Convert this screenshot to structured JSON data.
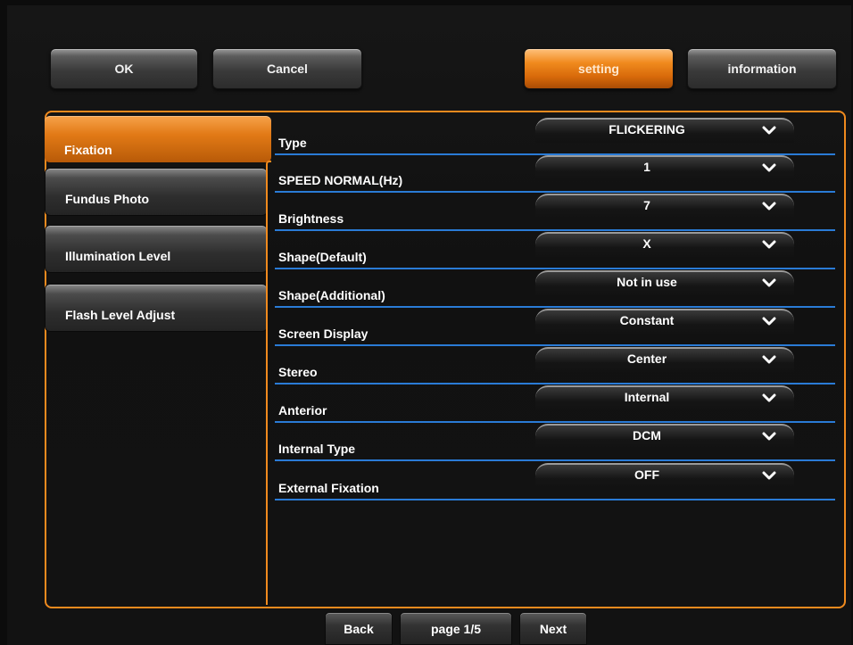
{
  "toolbar": {
    "ok": "OK",
    "cancel": "Cancel",
    "setting": "setting",
    "information": "information"
  },
  "sidebar": {
    "items": [
      {
        "label": "Fixation",
        "active": true
      },
      {
        "label": "Fundus Photo",
        "active": false
      },
      {
        "label": "Illumination Level",
        "active": false
      },
      {
        "label": "Flash Level Adjust",
        "active": false
      }
    ]
  },
  "settings": {
    "rows": [
      {
        "label": "Type",
        "value": "FLICKERING"
      },
      {
        "label": "SPEED NORMAL(Hz)",
        "value": "1"
      },
      {
        "label": "Brightness",
        "value": "7"
      },
      {
        "label": "Shape(Default)",
        "value": "X"
      },
      {
        "label": "Shape(Additional)",
        "value": "Not in use"
      },
      {
        "label": "Screen Display",
        "value": "Constant"
      },
      {
        "label": "Stereo",
        "value": "Center"
      },
      {
        "label": "Anterior",
        "value": "Internal"
      },
      {
        "label": "Internal Type",
        "value": "DCM"
      },
      {
        "label": "External Fixation",
        "value": "OFF"
      }
    ]
  },
  "pager": {
    "back": "Back",
    "page": "page 1/5",
    "next": "Next"
  },
  "colors": {
    "accent": "#f08a1e",
    "divider": "#2a7bd6"
  },
  "icons": {
    "dropdown": "chevron-down-icon"
  }
}
